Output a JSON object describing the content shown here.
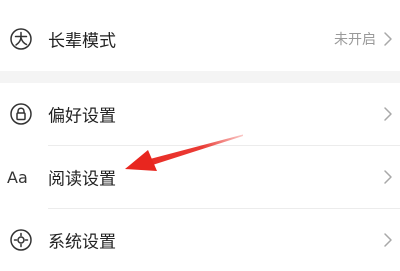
{
  "settings": {
    "elder_mode": {
      "label": "长辈模式",
      "value": "未开启",
      "icon": "elder-mode-icon"
    },
    "preferences": {
      "label": "偏好设置",
      "icon": "lock-icon"
    },
    "reading": {
      "label": "阅读设置",
      "icon_text": "Aa"
    },
    "system": {
      "label": "系统设置",
      "icon": "gear-icon"
    }
  },
  "colors": {
    "annotation_arrow": "#e8261f",
    "section_gap": "#f4f4f4"
  }
}
